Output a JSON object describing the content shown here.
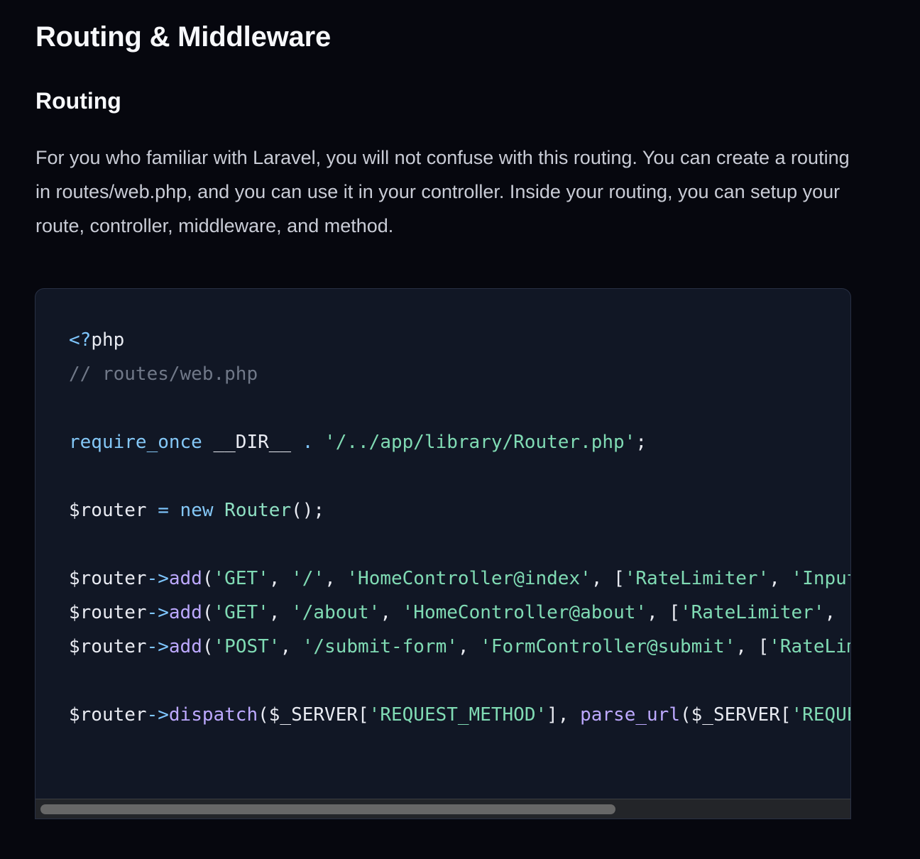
{
  "content": {
    "page_title": "Routing & Middleware",
    "section_title": "Routing",
    "paragraph": "For you who familiar with Laravel, you will not confuse with this routing. You can create a routing in routes/web.php, and you can use it in your controller. Inside your routing, you can setup your route, controller, middleware, and method."
  },
  "code": {
    "line_1": {
      "a": "<?",
      "b": "php"
    },
    "line_2": {
      "comment": "// routes/web.php"
    },
    "line_4": {
      "keyword": "require_once",
      "space_1": " ",
      "const": "__DIR__",
      "space_2": " ",
      "dot": ".",
      "space_3": " ",
      "string": "'/../app/library/Router.php'",
      "semi": ";"
    },
    "line_6": {
      "var": "$router",
      "space_1": " ",
      "equals": "=",
      "space_2": " ",
      "new": "new",
      "space_3": " ",
      "class": "Router",
      "tail": "();"
    },
    "line_8": {
      "var": "$router",
      "arrow": "->",
      "method": "add",
      "open": "(",
      "arg_1": "'GET'",
      "sep_1": ", ",
      "arg_2": "'/'",
      "sep_2": ", ",
      "arg_3": "'HomeController@index'",
      "sep_3": ", ",
      "bracket": "[",
      "arg_4": "'RateLimiter'",
      "sep_4": ", ",
      "arg_5": "'Input"
    },
    "line_9": {
      "var": "$router",
      "arrow": "->",
      "method": "add",
      "open": "(",
      "arg_1": "'GET'",
      "sep_1": ", ",
      "arg_2": "'/about'",
      "sep_2": ", ",
      "arg_3": "'HomeController@about'",
      "sep_3": ", ",
      "bracket": "[",
      "arg_4": "'RateLimiter'",
      "sep_4": ", ",
      "arg_5": "'"
    },
    "line_10": {
      "var": "$router",
      "arrow": "->",
      "method": "add",
      "open": "(",
      "arg_1": "'POST'",
      "sep_1": ", ",
      "arg_2": "'/submit-form'",
      "sep_2": ", ",
      "arg_3": "'FormController@submit'",
      "sep_3": ", ",
      "bracket": "[",
      "arg_4": "'RateLim"
    },
    "line_12": {
      "var": "$router",
      "arrow": "->",
      "method": "dispatch",
      "open": "(",
      "server_1": "$_SERVER",
      "bracket_1": "[",
      "key_1": "'REQUEST_METHOD'",
      "close_1": "], ",
      "fn": "parse_url",
      "open_2": "(",
      "server_2": "$_SERVER",
      "bracket_2": "[",
      "key_2": "'REQUE"
    }
  },
  "colors": {
    "background": "#06070e",
    "code_background": "#111725",
    "keyword": "#84c7f6",
    "string": "#80dbb4",
    "method": "#bda9ff",
    "comment": "#707888",
    "scroll_thumb": "#676767"
  },
  "scroll": {
    "horizontal_position_fraction": 0
  }
}
